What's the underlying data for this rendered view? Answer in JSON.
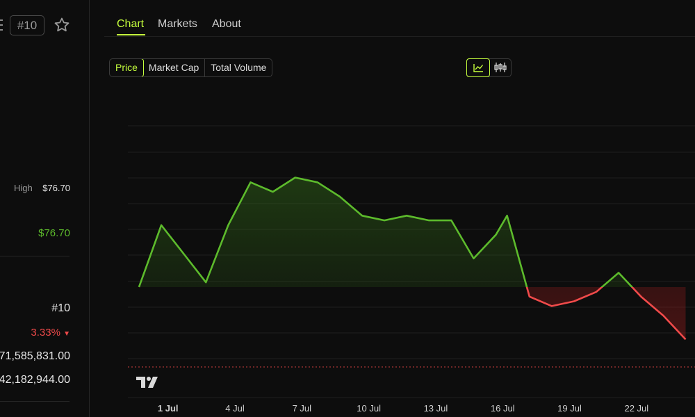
{
  "sidebar": {
    "rank_badge": "#10",
    "high_label": "High",
    "high_value": "$76.70",
    "price_value": "$76.70",
    "rank_value": "#10",
    "change_value": "3.33%",
    "change_arrow": "▼",
    "market_cap_value": "71,585,831.00",
    "volume_value": "42,182,944.00"
  },
  "tabs": [
    {
      "label": "Chart",
      "active": true
    },
    {
      "label": "Markets",
      "active": false
    },
    {
      "label": "About",
      "active": false
    }
  ],
  "metric_toggle": [
    {
      "label": "Price",
      "active": true
    },
    {
      "label": "Market Cap",
      "active": false
    },
    {
      "label": "Total Volume",
      "active": false
    }
  ],
  "chart_type_toggle": [
    {
      "icon": "line-chart-icon",
      "active": true
    },
    {
      "icon": "candlestick-icon",
      "active": false
    }
  ],
  "colors": {
    "accent": "#c5ff3d",
    "up": "#5dbb2c",
    "down": "#f04a4a",
    "background": "#0d0d0d"
  },
  "chart_data": {
    "type": "area",
    "title": "",
    "xlabel": "",
    "ylabel": "",
    "x_tick_labels": [
      "1 Jul",
      "4 Jul",
      "7 Jul",
      "10 Jul",
      "13 Jul",
      "16 Jul",
      "19 Jul",
      "22 Jul"
    ],
    "x_tick_days": [
      1,
      4,
      7,
      10,
      13,
      16,
      19,
      22
    ],
    "baseline": 74.2,
    "legend": "none",
    "grid": true,
    "series": [
      {
        "x": [
          -0.3,
          0.7,
          1.7,
          2.7,
          3.7,
          4.7,
          5.7,
          6.7,
          7.7,
          8.7,
          9.7,
          10.7,
          11.7,
          12.7,
          13.7,
          14.7,
          15.7,
          16.2,
          17.2,
          18.2,
          19.2,
          20.2,
          21.2,
          22.2,
          23.2,
          24.2
        ],
        "y": [
          74.2,
          75.5,
          74.9,
          74.3,
          75.5,
          76.4,
          76.2,
          76.5,
          76.4,
          76.1,
          75.7,
          75.6,
          75.7,
          75.6,
          75.6,
          74.8,
          75.3,
          75.7,
          74.0,
          73.8,
          73.9,
          74.1,
          74.5,
          74.0,
          73.6,
          73.1
        ]
      }
    ]
  }
}
